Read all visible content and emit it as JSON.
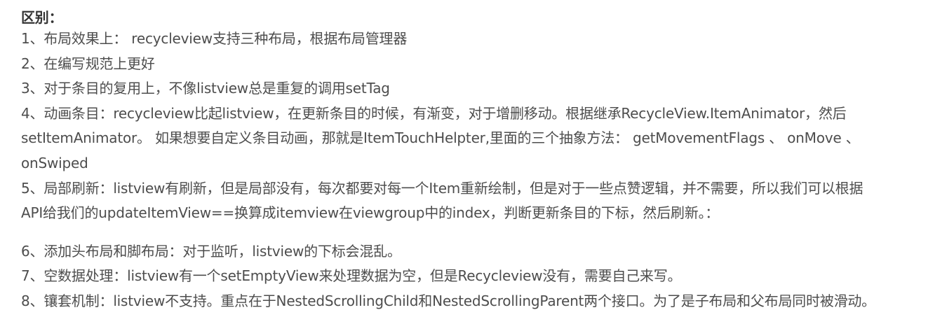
{
  "heading": "区别：",
  "lines": {
    "l1": "1、布局效果上： recycleview支持三种布局，根据布局管理器",
    "l2": "2、在编写规范上更好",
    "l3": "3、对于条目的复用上，不像listview总是重复的调用setTag",
    "l4a": "4、动画条目：recycleview比起listview，在更新条目的时候，有渐变，对于增删移动。根据继承RecycleView.ItemAnimator，然后",
    "l4b": "setItemAnimator。 如果想要自定义条目动画，那就是ItemTouchHelpter,里面的三个抽象方法： getMovementFlags 、 onMove 、",
    "l4c": "onSwiped",
    "l5a": "5、局部刷新：listview有刷新，但是局部没有，每次都要对每一个Item重新绘制，但是对于一些点赞逻辑，并不需要，所以我们可以根据",
    "l5b": "API给我们的updateItemView==换算成itemview在viewgroup中的index，判断更新条目的下标，然后刷新。：",
    "l6": "6、添加头布局和脚布局：对于监听，listview的下标会混乱。",
    "l7": "7、空数据处理：listview有一个setEmptyView来处理数据为空，但是Recycleview没有，需要自己来写。",
    "l8": "8、镶套机制：listview不支持。重点在于NestedScrollingChild和NestedScrollingParent两个接口。为了是子布局和父布局同时被滑动。"
  }
}
